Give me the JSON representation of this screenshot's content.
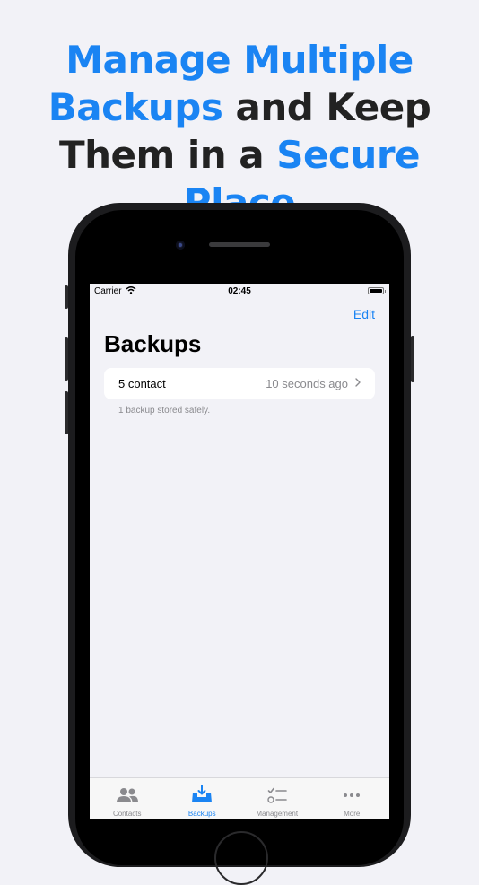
{
  "headline": {
    "line1": "Manage Multiple",
    "line2_highlight": "Backups",
    "line2_rest": " and Keep",
    "line3_prefix": "Them in a ",
    "line3_highlight": "Secure Place"
  },
  "status_bar": {
    "carrier": "Carrier",
    "time": "02:45"
  },
  "nav": {
    "edit": "Edit",
    "title": "Backups"
  },
  "backups": [
    {
      "label": "5 contact",
      "detail": "10 seconds ago"
    }
  ],
  "footer": "1 backup stored safely.",
  "tabs": [
    {
      "label": "Contacts",
      "icon": "contacts-icon",
      "active": false
    },
    {
      "label": "Backups",
      "icon": "backup-tray-icon",
      "active": true
    },
    {
      "label": "Management",
      "icon": "checklist-icon",
      "active": false
    },
    {
      "label": "More",
      "icon": "more-icon",
      "active": false
    }
  ],
  "colors": {
    "accent": "#1a84f3",
    "headline_text": "#222222",
    "background": "#f2f2f7"
  }
}
